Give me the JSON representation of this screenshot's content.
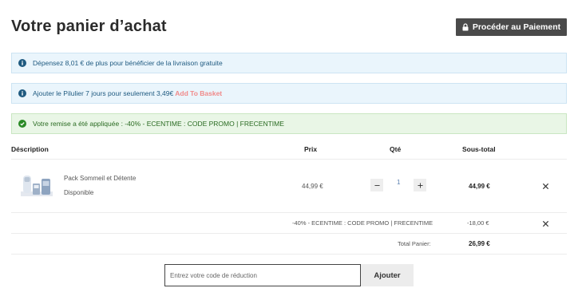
{
  "page": {
    "title": "Votre panier d’achat"
  },
  "checkout": {
    "label": "Procéder au Paiement",
    "icon": "lock-icon"
  },
  "alerts": {
    "free_shipping": {
      "text": "Dépensez 8,01 € de plus pour bénéficier de la livraison gratuite",
      "icon": "info-icon"
    },
    "upsell": {
      "text": "Ajouter le Pilulier 7 jours pour seulement 3,49€",
      "link": "Add To Basket",
      "icon": "info-icon"
    },
    "discount": {
      "text": "Votre remise a été appliquée : -40% - ECENTIME : CODE PROMO | FRECENTIME",
      "icon": "check-circle-icon"
    }
  },
  "table": {
    "headers": {
      "description": "Déscription",
      "price": "Prix",
      "qty": "Qté",
      "subtotal": "Sous-total"
    },
    "items": [
      {
        "name": "Pack Sommeil et Détente",
        "status": "Disponible",
        "price": "44,99 €",
        "qty": "1",
        "subtotal": "44,99 €"
      }
    ]
  },
  "summary": {
    "discount_label": "-40% - ECENTIME : CODE PROMO | FRECENTIME",
    "discount_value": "-18,00 €",
    "total_label": "Total Panier:",
    "total_value": "26,99 €"
  },
  "promo": {
    "placeholder": "Entrez votre code de réduction",
    "button": "Ajouter"
  },
  "colors": {
    "dark_button": "#4a4a4a",
    "info_bg": "#eaf5fc",
    "success_bg": "#e9f6e6",
    "link_accent": "#f08a8a"
  }
}
